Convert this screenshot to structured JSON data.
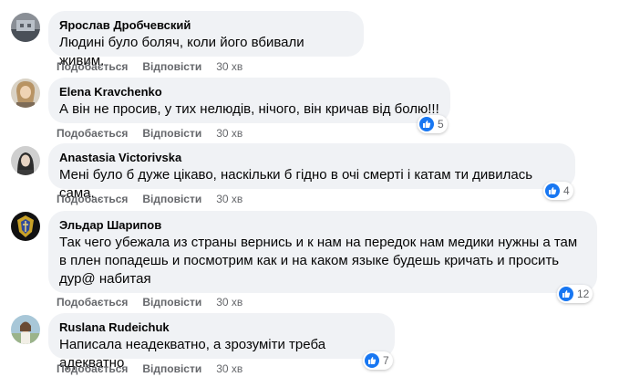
{
  "actions": {
    "like": "Подобається",
    "reply": "Відповісти"
  },
  "comments": [
    {
      "author": "Ярослав Дробчевский",
      "text": "Людині було боляч, коли його вбивали живим.",
      "time": "30 хв",
      "likes": ""
    },
    {
      "author": "Elena Kravchenko",
      "text": "А він не просив, у тих нелюдів, нічого, він кричав від болю!!!",
      "time": "30 хв",
      "likes": "5"
    },
    {
      "author": "Anastasia Victorivska",
      "text": "Мені було б дуже цікаво, наскільки б гідно в очі смерті і катам ти дивилась сама.",
      "time": "30 хв",
      "likes": "4"
    },
    {
      "author": "Эльдар Шарипов",
      "text": "Так чего убежала из страны вернись и к нам на передок нам медики нужны а там в плен попадешь и посмотрим как и на каком языке будешь кричать и просить дур@ набитая",
      "time": "30 хв",
      "likes": "12"
    },
    {
      "author": "Ruslana Rudeichuk",
      "text": "Написала неадекватно, а зрозуміти треба адекватно",
      "time": "30 хв",
      "likes": "7"
    }
  ]
}
